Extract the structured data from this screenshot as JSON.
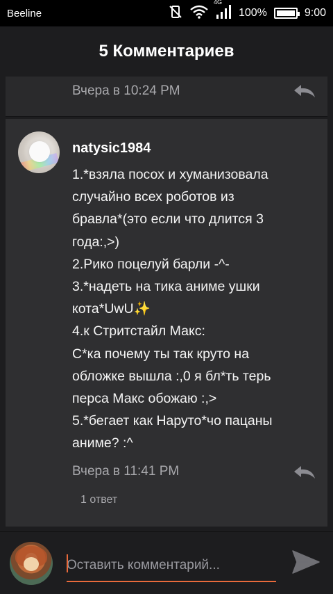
{
  "status_bar": {
    "carrier": "Beeline",
    "network": "4G",
    "battery_percent": "100%",
    "time": "9:00"
  },
  "header": {
    "title": "5 Комментариев"
  },
  "previous_comment": {
    "date": "Вчера в 10:24 PM"
  },
  "comment": {
    "username": "natysic1984",
    "lines": [
      "1.*взяла посох и хуманизовала",
      "случайно всех роботов из",
      "бравла*(это если что длится 3",
      "года:,>)",
      "2.Рико поцелуй барли -^-",
      "3.*надеть на тика аниме ушки",
      "кота*UwU",
      "4.к Стритстайл Макс:",
      "С*ка почему ты так круто на",
      "обложке вышла :,0 я бл*ть терь",
      "перса Макс обожаю :,>",
      "5.*бегает как Наруто*чо пацаны",
      "аниме? :^"
    ],
    "sparkle": "✨",
    "date": "Вчера в 11:41 PM",
    "replies": "1 ответ"
  },
  "input": {
    "placeholder": "Оставить комментарий..."
  },
  "colors": {
    "accent": "#e96a3b",
    "card_bg": "#2f2f31",
    "page_bg": "#1d1d1f"
  },
  "icons": {
    "reply": "reply-arrow-icon",
    "send": "send-icon",
    "wifi": "wifi-icon",
    "mute": "vibrate-off-icon",
    "signal": "signal-icon",
    "battery": "battery-icon"
  }
}
